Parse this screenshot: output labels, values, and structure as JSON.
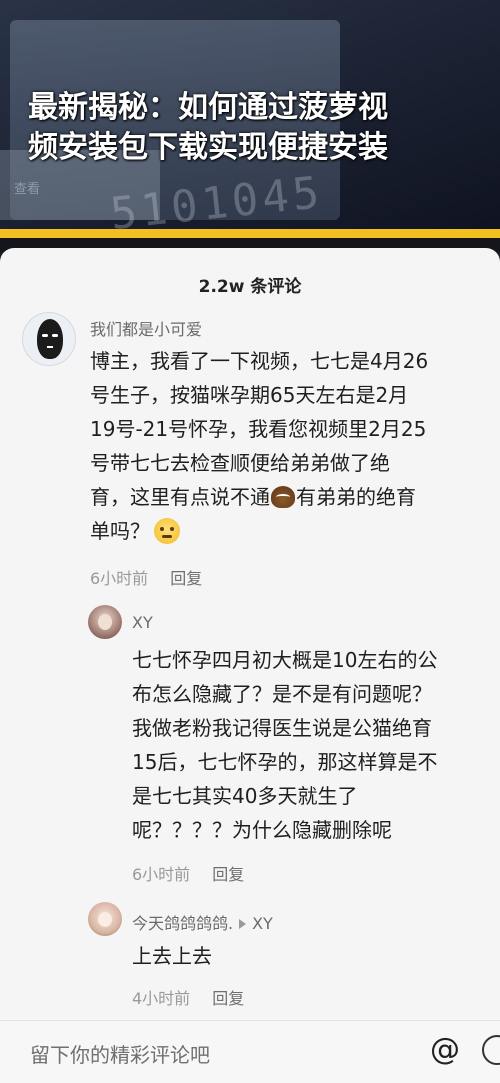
{
  "banner": {
    "headline_line1": "最新揭秘：如何通过菠萝视",
    "headline_line2": "频安装包下载实现便捷安装",
    "bg_number": "5101045",
    "bg_label": "查看"
  },
  "comments_sheet": {
    "title": "2.2w 条评论",
    "comments": [
      {
        "username": "我们都是小可爱",
        "lines": [
          "博主，我看了一下视频，七七是4月26",
          "号生子，按猫咪孕期65天左右是2月",
          "19号-21号怀孕，我看您视频里2月25",
          "号带七七去检查顺便给弟弟做了绝",
          "育，这里有点说不通",
          "有弟弟的绝育",
          "单吗？"
        ],
        "time": "6小时前",
        "reply_label": "回复",
        "emoji1": "poop-emoji",
        "emoji2": "thinking-emoji"
      },
      {
        "username": "XY",
        "lines": [
          "七七怀孕四月初大概是10左右的公",
          "布怎么隐藏了？是不是有问题呢？",
          "我做老粉我记得医生说是公猫绝育",
          "15后，七七怀孕的，那这样算是不",
          "是七七其实40多天就生了",
          "呢？？？？为什么隐藏删除呢"
        ],
        "time": "6小时前",
        "reply_label": "回复"
      },
      {
        "username": "今天鸽鸽鸽鸽.",
        "reply_to": "XY",
        "lines": [
          "上去上去"
        ],
        "time": "4小时前",
        "reply_label": "回复"
      }
    ]
  },
  "input_bar": {
    "placeholder": "留下你的精彩评论吧",
    "at_symbol": "@"
  },
  "colors": {
    "accent_yellow": "#f2c020",
    "sheet_bg": "#f5f5f5",
    "text_primary": "#1f1f1f",
    "text_meta": "#9a9a9a"
  }
}
